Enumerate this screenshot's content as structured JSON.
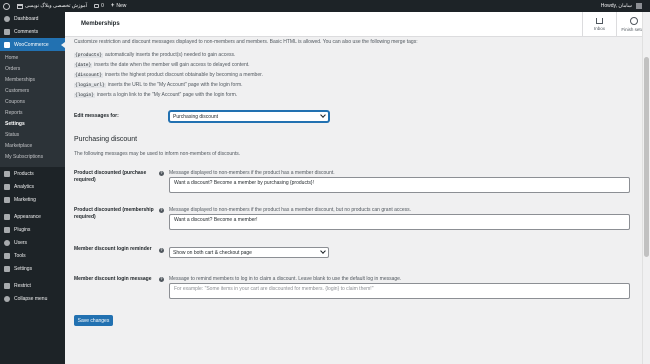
{
  "admin_bar": {
    "site_name": "آموزش تخصصی وبلاگ نویسی",
    "comments_count": "0",
    "new_label": "New",
    "greeting": "Howdy, سامان"
  },
  "sidebar": {
    "top_items": [
      {
        "label": "Dashboard",
        "icon": "dashboard-icon"
      },
      {
        "label": "Comments",
        "icon": "comments-icon"
      }
    ],
    "current": {
      "label": "WooCommerce",
      "icon": "woocommerce-icon"
    },
    "submenu": [
      "Home",
      "Orders",
      "Memberships",
      "Customers",
      "Coupons",
      "Reports",
      "Settings",
      "Status",
      "Marketplace",
      "My Subscriptions"
    ],
    "submenu_current": "Settings",
    "bottom_items": [
      {
        "label": "Products",
        "icon": "products-icon"
      },
      {
        "label": "Analytics",
        "icon": "analytics-icon"
      },
      {
        "label": "Marketing",
        "icon": "marketing-icon"
      },
      {
        "label": "Appearance",
        "icon": "appearance-icon"
      },
      {
        "label": "Plugins",
        "icon": "plugins-icon"
      },
      {
        "label": "Users",
        "icon": "users-icon"
      },
      {
        "label": "Tools",
        "icon": "tools-icon"
      },
      {
        "label": "Settings",
        "icon": "settings-icon"
      },
      {
        "label": "Restrict",
        "icon": "restrict-icon"
      },
      {
        "label": "Collapse menu",
        "icon": "collapse-icon"
      }
    ]
  },
  "header": {
    "title": "Memberships",
    "inbox_label": "Inbox",
    "finish_setup_label": "Finish setup"
  },
  "content": {
    "intro": "Customize restriction and discount messages displayed to non-members and members. Basic HTML is allowed. You can also use the following merge tags:",
    "merge_tags": [
      {
        "tag": "{products}",
        "desc": "automatically inserts the product(s) needed to gain access."
      },
      {
        "tag": "{date}",
        "desc": "inserts the date when the member will gain access to delayed content."
      },
      {
        "tag": "{discount}",
        "desc": "inserts the highest product discount obtainable by becoming a member."
      },
      {
        "tag": "{login_url}",
        "desc": "inserts the URL to the \"My Account\" page with the login form."
      },
      {
        "tag": "{login}",
        "desc": "inserts a login link to the \"My Account\" page with the login form."
      }
    ],
    "edit_messages": {
      "label": "Edit messages for:",
      "selected": "Purchasing discount"
    },
    "section_title": "Purchasing discount",
    "section_desc": "The following messages may be used to inform non-members of discounts.",
    "fields": {
      "purchase_required": {
        "label": "Product discounted (purchase required)",
        "desc": "Message displayed to non-members if the product has a member discount.",
        "value": "Want a discount? Become a member by purchasing {products}!"
      },
      "membership_required": {
        "label": "Product discounted (membership required)",
        "desc": "Message displayed to non-members if the product has a member discount, but no products can grant access.",
        "value": "Want a discount? Become a member!"
      },
      "login_reminder": {
        "label": "Member discount login reminder",
        "selected": "Show on both cart & checkout page"
      },
      "login_message": {
        "label": "Member discount login message",
        "desc": "Message to remind members to log in to claim a discount. Leave blank to use the default log in message.",
        "placeholder": "For example: \"Some items in your cart are discounted for members. {login} to claim them!\""
      }
    },
    "save_label": "Save changes"
  },
  "colors": {
    "accent": "#2271b1",
    "sidebar_bg": "#1d2327",
    "page_bg": "#f0f0f1"
  }
}
